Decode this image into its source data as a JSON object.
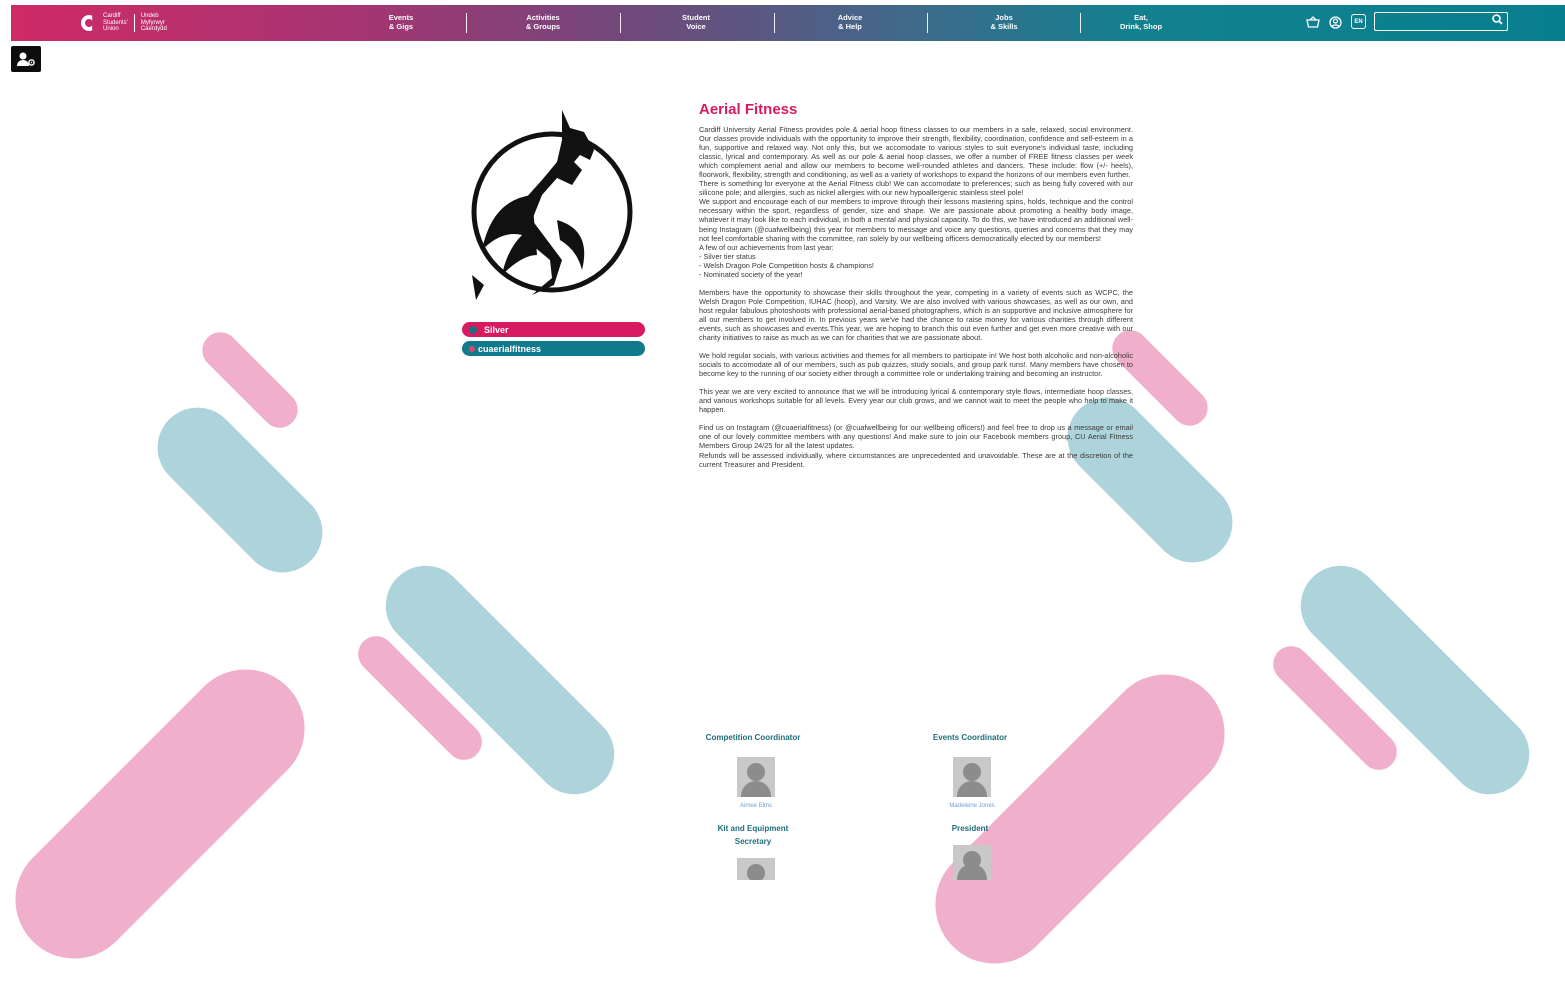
{
  "colors": {
    "accent": "#d81b60",
    "teal": "#087f8f",
    "pink_deco": "#f0afcb",
    "blue_deco": "#aed4db"
  },
  "header": {
    "logo_text": "Cardiff\nStudents'\nUnion",
    "logo_text_welsh": "Undeb\nMyfyrwyr\nCaerdydd",
    "nav": [
      {
        "label": "Events\n& Gigs"
      },
      {
        "label": "Activities\n& Groups"
      },
      {
        "label": "Student\nVoice"
      },
      {
        "label": "Advice\n& Help"
      },
      {
        "label": "Jobs\n& Skills"
      },
      {
        "label": "Eat,\nDrink, Shop"
      }
    ],
    "basket_icon": "basket-icon",
    "account_icon": "account-icon",
    "lang_label": "EN",
    "search_placeholder": "",
    "search_icon": "search-icon"
  },
  "admin_icon": "user-settings-icon",
  "club": {
    "name": "Aerial Fitness",
    "tier": "Silver",
    "instagram": "cuaerialfitness",
    "description": [
      "Cardiff University Aerial Fitness provides pole & aerial hoop fitness classes to our members in a safe, relaxed, social environment. Our classes provide individuals with the opportunity to improve their strength, flexibility, coordination, confidence and self-esteem in a fun, supportive and relaxed way. Not only this, but we accomodate to various styles to suit everyone's individual taste, including classic, lyrical and contemporary. As well as our pole & aerial hoop classes, we offer a number of FREE fitness classes per week which complement aerial and allow our members to become well-rounded athletes and dancers. These include: flow (+/- heels), floorwork, flexibility, strength and conditioning, as well as a variety of workshops to expand the horizons of our members even further.",
      "There is something for everyone at the Aerial Fitness club! We can accomodate to preferences; such as being fully covered with our silicone pole; and allergies, such as nickel allergies with our new hypoallergenic stainless steel pole!",
      "We support and encourage each of our members to improve through their lessons mastering spins, holds, technique and the control necessary within the sport, regardless of gender, size and shape. We are passionate about promoting a healthy body image, whatever it may look like to each individual, in both a mental and physical capacity. To do this, we have introduced an additional well-being Instagram (@cuafwellbeing) this year for members to message and voice any questions, queries and concerns that they may not feel comfortable sharing with the committee, ran solely by our wellbeing officers democratically elected by our members!",
      "A few of our achievements from last year:",
      "- Silver tier status",
      "- Welsh Dragon Pole Competition hosts & champions!",
      "- Nominated society of the year!",
      "",
      "Members have the opportunity to showcase their skills throughout the year, competing in a variety of events such as WCPC, the Welsh Dragon Pole Competition, IUHAC (hoop), and Varsity. We are also involved with various showcases, as well as our own, and host regular fabulous photoshoots with professional aerial-based photographers, which is an supportive and inclusive atmosphere for all our members to get involved in. In previous years we've had the chance to raise money for various charities through different events, such as showcases and events.This year, we are hoping to branch this out even further and get even more creative with our charity initiatives to raise as much as we can for charities that we are passionate about.",
      "",
      "We hold regular socials, with various activities and themes for all members to participate in! We host both alcoholic and non-alcoholic socials to accomodate all of our members, such as pub quizzes, study socials, and group park runs!. Many members have chosen to become key to the running of our society either through a committee role or undertaking training and becoming an instructor.",
      "",
      "This year we are very excited to announce that we will be introducing lyrical & contemporary style flows, intermediate hoop classes, and various workshops suitable for all levels. Every year our club grows, and we cannot wait to meet the people who help to make it happen.",
      "",
      "Find us on Instagram (@cuaerialfitness) (or @cuafwellbeing for our wellbeing officers!) and feel free to drop us a message or email one of our lovely committee members with any questions! And make sure to join our Facebook members group, CU Aerial Fitness Members Group 24/25 for all the latest updates.",
      "Refunds will be assessed individually, where circumstances are unprecedented and unavoidable. These are at the discretion of the current Treasurer and President."
    ]
  },
  "committee": [
    {
      "role": "Competition Coordinator",
      "name": "Aimee Elms"
    },
    {
      "role": "Events Coordinator",
      "name": "Madeleine Jones"
    },
    {
      "role": "Kit and Equipment\nSecretary",
      "name": ""
    },
    {
      "role": "President",
      "name": ""
    }
  ]
}
